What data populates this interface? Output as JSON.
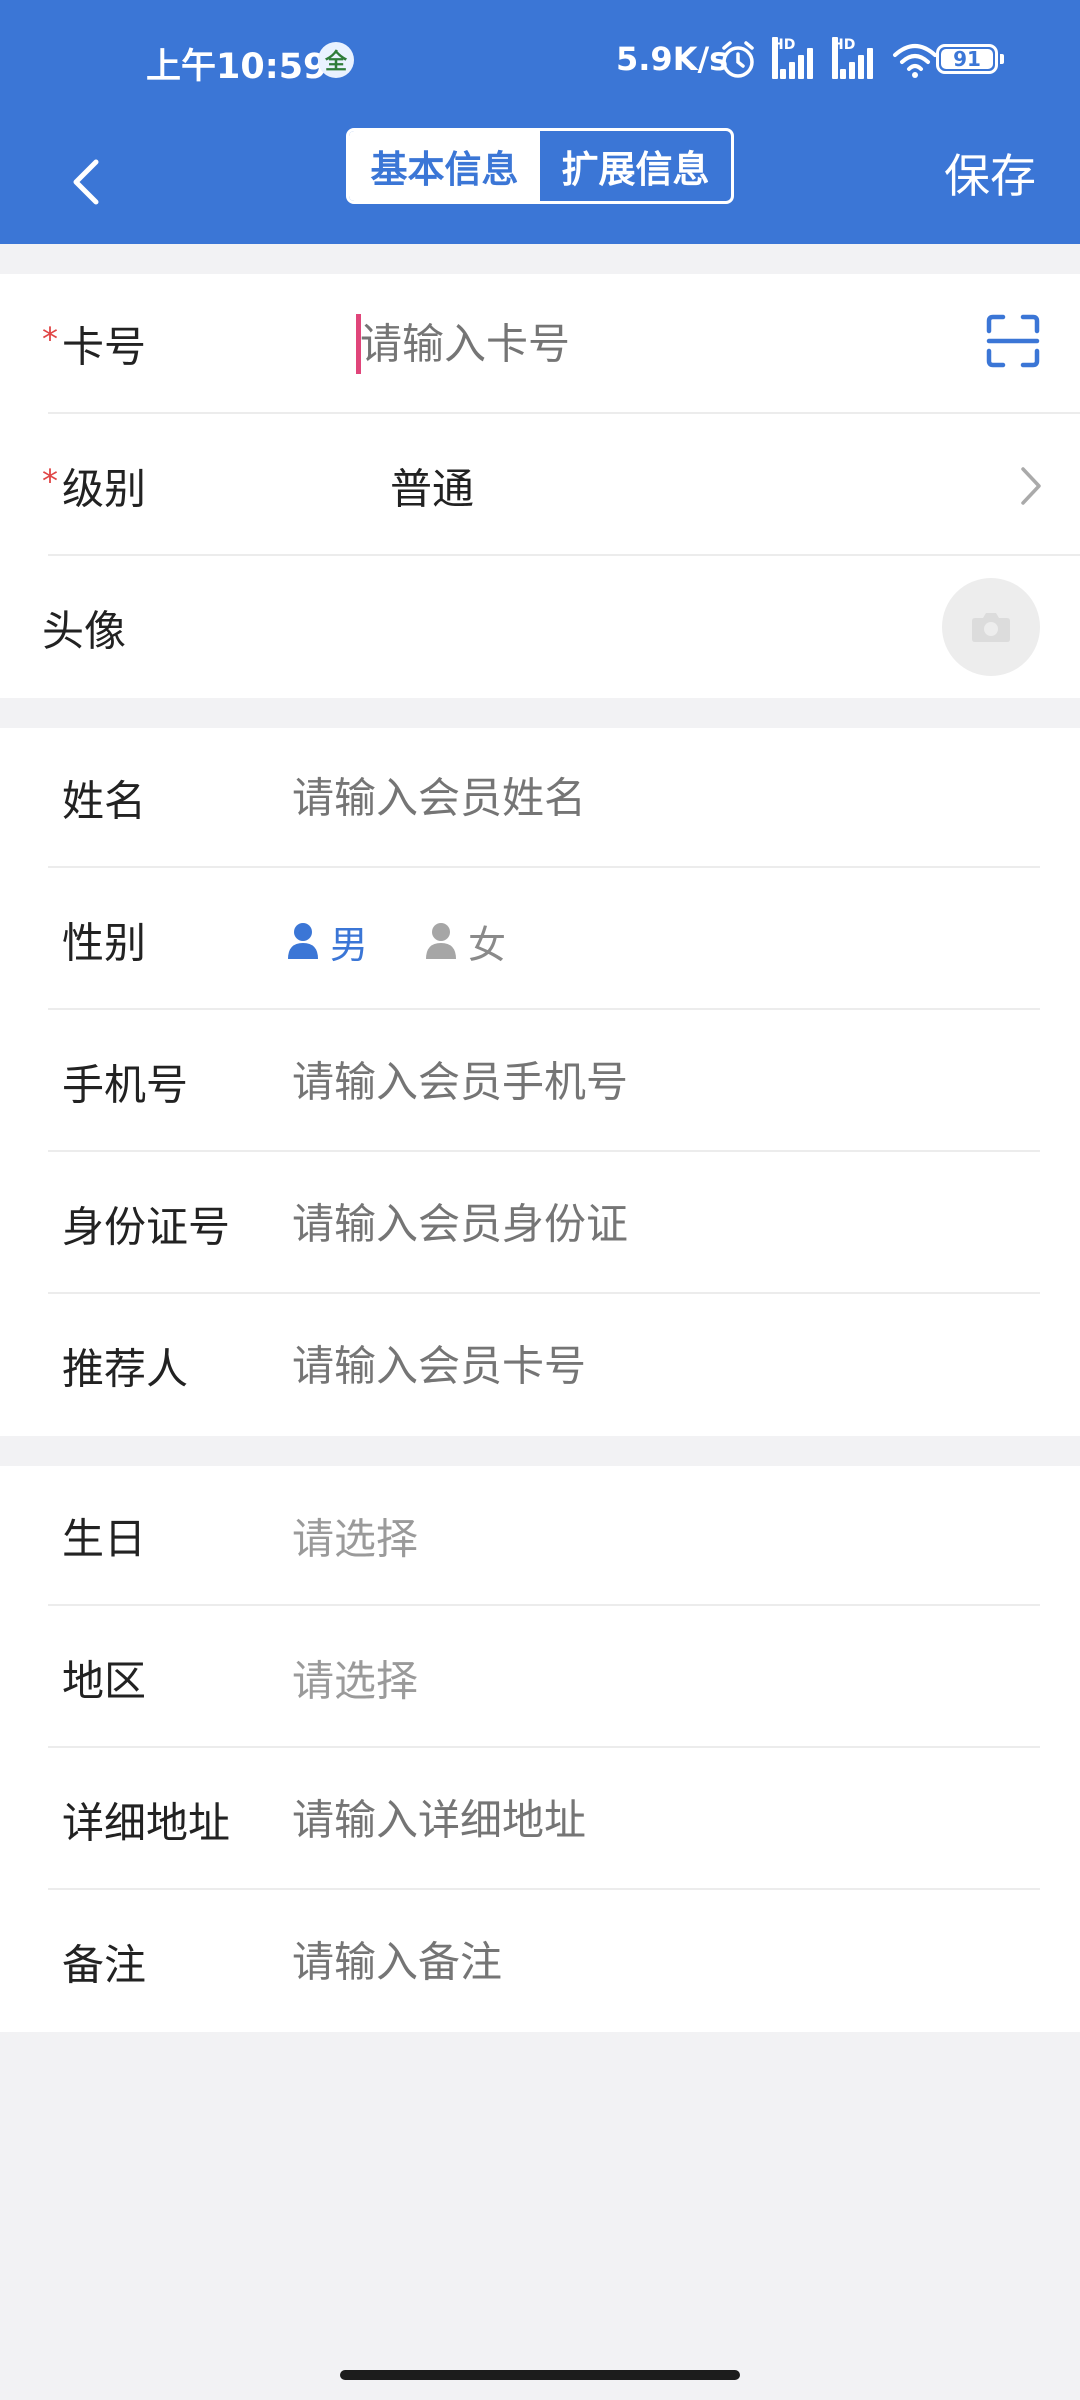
{
  "status_bar": {
    "time": "上午10:59",
    "carrier_badge": "全",
    "net_speed": "5.9K/s",
    "battery": "91",
    "icons": [
      "alarm-icon",
      "signal-hd-icon",
      "signal-hd-icon",
      "wifi-icon",
      "battery-icon"
    ]
  },
  "nav": {
    "back_icon": "chevron-left-icon",
    "tab_basic": "基本信息",
    "tab_extended": "扩展信息",
    "save": "保存"
  },
  "colors": {
    "primary": "#3b76d6",
    "required": "#e04545",
    "cursor": "#e0457a",
    "placeholder": "#9a9a9a"
  },
  "form": {
    "card_no": {
      "required_mark": "*",
      "label": "卡号",
      "placeholder": "请输入卡号",
      "icon": "scan-icon"
    },
    "level": {
      "required_mark": "*",
      "label": "级别",
      "value": "普通",
      "icon": "chevron-right-icon"
    },
    "avatar": {
      "label": "头像",
      "icon": "camera-icon"
    },
    "name": {
      "label": "姓名",
      "placeholder": "请输入会员姓名"
    },
    "gender": {
      "label": "性别",
      "male": "男",
      "female": "女",
      "selected": "男"
    },
    "phone": {
      "label": "手机号",
      "placeholder": "请输入会员手机号"
    },
    "id_card": {
      "label": "身份证号",
      "placeholder": "请输入会员身份证"
    },
    "referrer": {
      "label": "推荐人",
      "placeholder": "请输入会员卡号"
    },
    "birthday": {
      "label": "生日",
      "placeholder": "请选择"
    },
    "region": {
      "label": "地区",
      "placeholder": "请选择"
    },
    "address": {
      "label": "详细地址",
      "placeholder": "请输入详细地址"
    },
    "remark": {
      "label": "备注",
      "placeholder": "请输入备注"
    }
  }
}
